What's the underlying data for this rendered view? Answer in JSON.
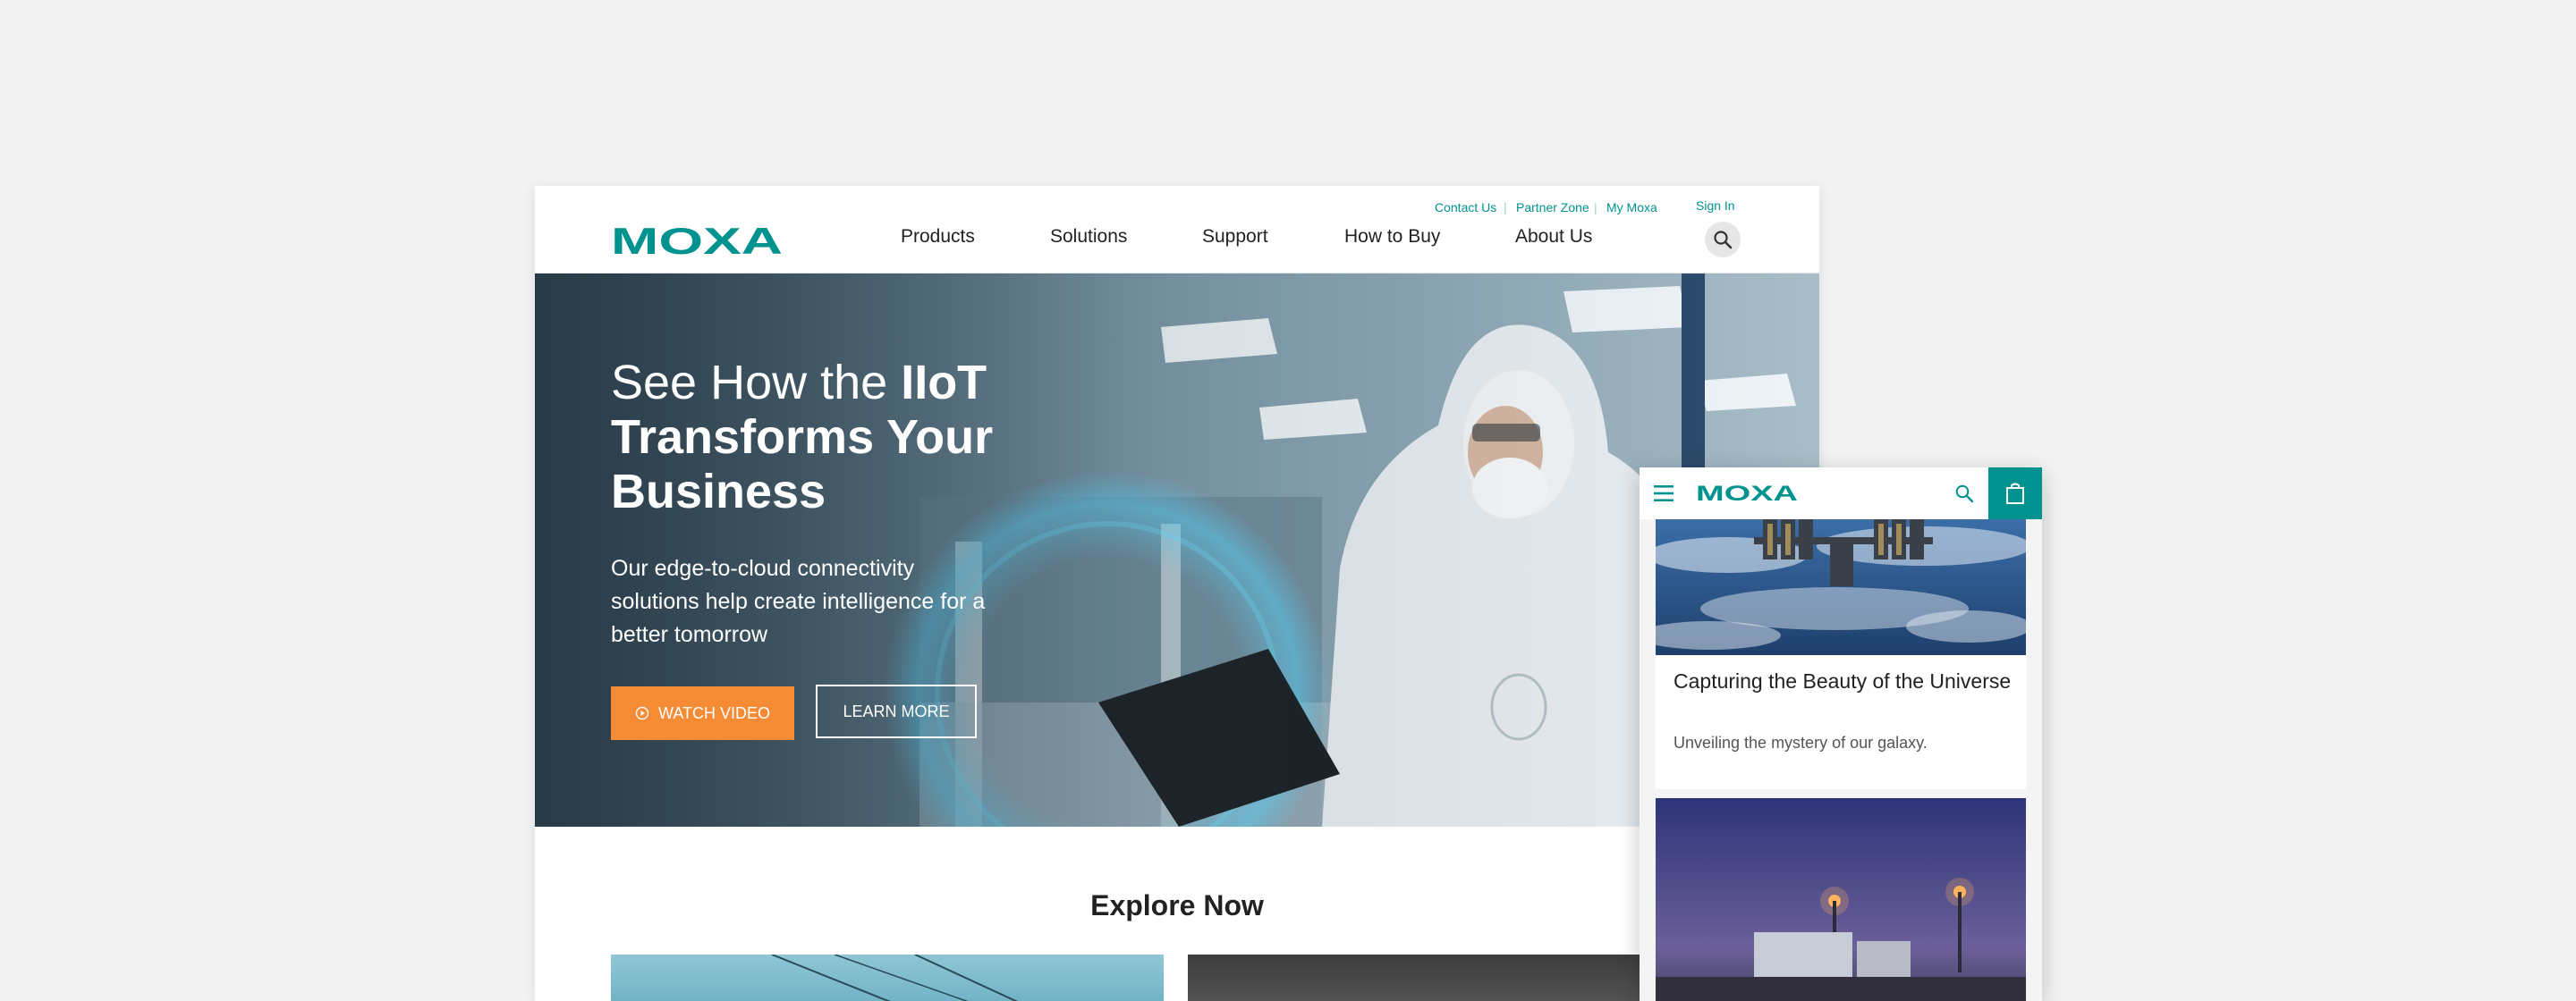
{
  "colors": {
    "brand": "#00928e",
    "accent": "#f58b34"
  },
  "desktop": {
    "util_links": [
      "Contact Us",
      "Partner Zone",
      "My Moxa"
    ],
    "sign_in": "Sign In",
    "brand": "MOXA",
    "menu": [
      "Products",
      "Solutions",
      "Support",
      "How to Buy",
      "About Us"
    ],
    "search_icon": "search-icon",
    "hero": {
      "title_light": "See How the ",
      "title_bold": "IIoT Transforms Your Business",
      "subtitle": "Our edge-to-cloud connectivity solutions help create intelligence for a better tomorrow",
      "watch_label": "WATCH VIDEO",
      "learn_label": "LEARN MORE"
    },
    "explore_title": "Explore Now"
  },
  "mobile": {
    "brand": "MOXA",
    "icons": [
      "menu-icon",
      "search-icon",
      "cart-icon"
    ],
    "card": {
      "title": "Capturing the Beauty of the Universe",
      "description": "Unveiling the mystery of our galaxy."
    }
  }
}
